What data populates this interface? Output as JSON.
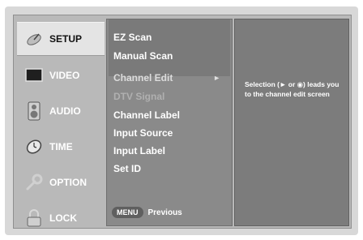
{
  "tabs": [
    {
      "label": "SETUP",
      "icon": "satellite-dish-icon",
      "active": true
    },
    {
      "label": "VIDEO",
      "icon": "tv-screen-icon",
      "active": false
    },
    {
      "label": "AUDIO",
      "icon": "speaker-icon",
      "active": false
    },
    {
      "label": "TIME",
      "icon": "clock-icon",
      "active": false
    },
    {
      "label": "OPTION",
      "icon": "wrench-icon",
      "active": false
    },
    {
      "label": "LOCK",
      "icon": "padlock-icon",
      "active": false
    }
  ],
  "menu": {
    "items": [
      {
        "label": "EZ Scan"
      },
      {
        "label": "Manual Scan"
      },
      {
        "label": "Channel Edit",
        "arrow": "►"
      },
      {
        "label": "DTV Signal"
      },
      {
        "label": "Channel Label"
      },
      {
        "label": "Input Source"
      },
      {
        "label": "Input Label"
      },
      {
        "label": "Set ID"
      }
    ],
    "footer": {
      "key_label": "MENU",
      "action_label": "Previous"
    }
  },
  "help": {
    "text": "Selection (► or ◉) leads you to the channel edit screen"
  },
  "colors": {
    "osd_bg": "#d8d8d8",
    "panel_bg": "#8a8a8a",
    "active_tab": "#e4e4e4"
  }
}
